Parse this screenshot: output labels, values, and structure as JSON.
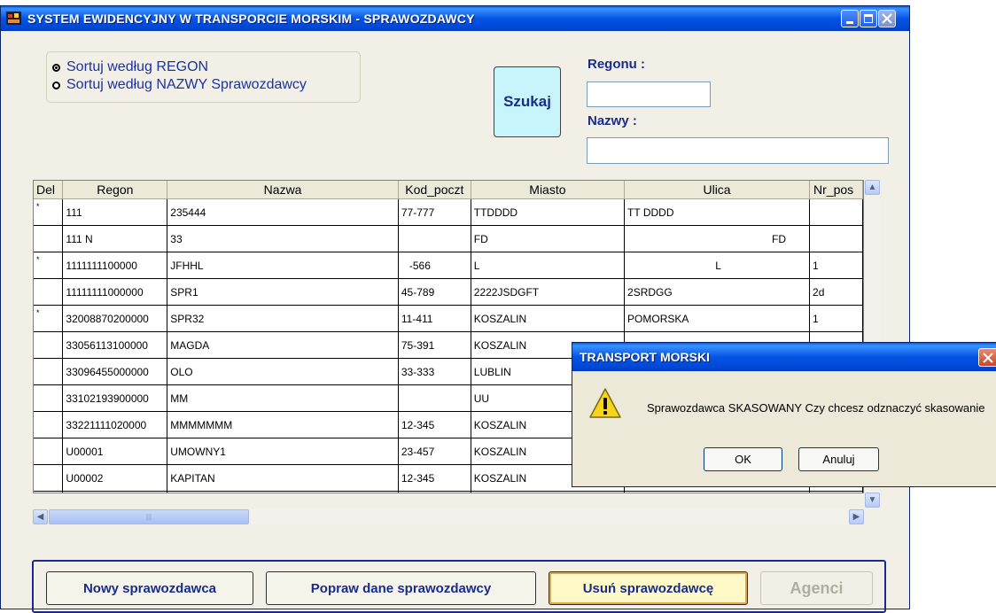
{
  "window": {
    "title": "SYSTEM EWIDENCYJNY W TRANSPORCIE MORSKIM - SPRAWOZDAWCY",
    "icon": "app-ship-icon"
  },
  "sort": {
    "options": [
      "Sortuj według REGON",
      "Sortuj według NAZWY Sprawozdawcy"
    ],
    "selected": 0
  },
  "search": {
    "button_label": "Szukaj",
    "regon_label": "Regonu :",
    "regon_value": "",
    "nazwa_label": "Nazwy :",
    "nazwa_value": ""
  },
  "grid": {
    "columns": [
      "Del",
      "Regon",
      "Nazwa",
      "Kod_poczt",
      "Miasto",
      "Ulica",
      "Nr_pos"
    ],
    "rows": [
      [
        "*",
        "111",
        "235444",
        "77-777",
        "TTDDDD",
        "TT     DDDD",
        ""
      ],
      [
        "",
        "111          N",
        "33",
        "",
        "FD",
        "FD",
        ""
      ],
      [
        "*",
        "1111111100000",
        "JFHHL",
        "-566",
        "L",
        "L",
        "1"
      ],
      [
        "",
        "11111111000000",
        "SPR1",
        "45-789",
        "2222JSDGFT",
        "2SRDGG",
        "2d"
      ],
      [
        "*",
        "32008870200000",
        "SPR32",
        "11-411",
        "KOSZALIN",
        "POMORSKA",
        "1"
      ],
      [
        "",
        "33056113100000",
        "MAGDA",
        "75-391",
        "KOSZALIN",
        "",
        ""
      ],
      [
        "",
        "33096455000000",
        "OLO",
        "33-333",
        "LUBLIN",
        "",
        ""
      ],
      [
        "",
        "33102193900000",
        "MM",
        "",
        "UU",
        "",
        ""
      ],
      [
        "",
        "33221111020000",
        "MMMMMMM",
        "12-345",
        "KOSZALIN",
        "",
        ""
      ],
      [
        "",
        "U00001",
        "UMOWNY1",
        "23-457",
        "KOSZALIN",
        "",
        ""
      ],
      [
        "",
        "U00002",
        "KAPITAN",
        "12-345",
        "KOSZALIN",
        "",
        ""
      ],
      [
        "",
        "",
        "",
        "",
        "",
        "",
        ""
      ]
    ]
  },
  "buttons": {
    "new": "Nowy sprawozdawca",
    "edit": "Popraw dane sprawozdawcy",
    "delete": "Usuń sprawozdawcę",
    "agents": "Agenci"
  },
  "dialog": {
    "title": "TRANSPORT MORSKI",
    "message": "Sprawozdawca SKASOWANY Czy chcesz odznaczyć skasowanie",
    "ok": "OK",
    "cancel": "Anuluj",
    "icon": "warning-icon"
  }
}
